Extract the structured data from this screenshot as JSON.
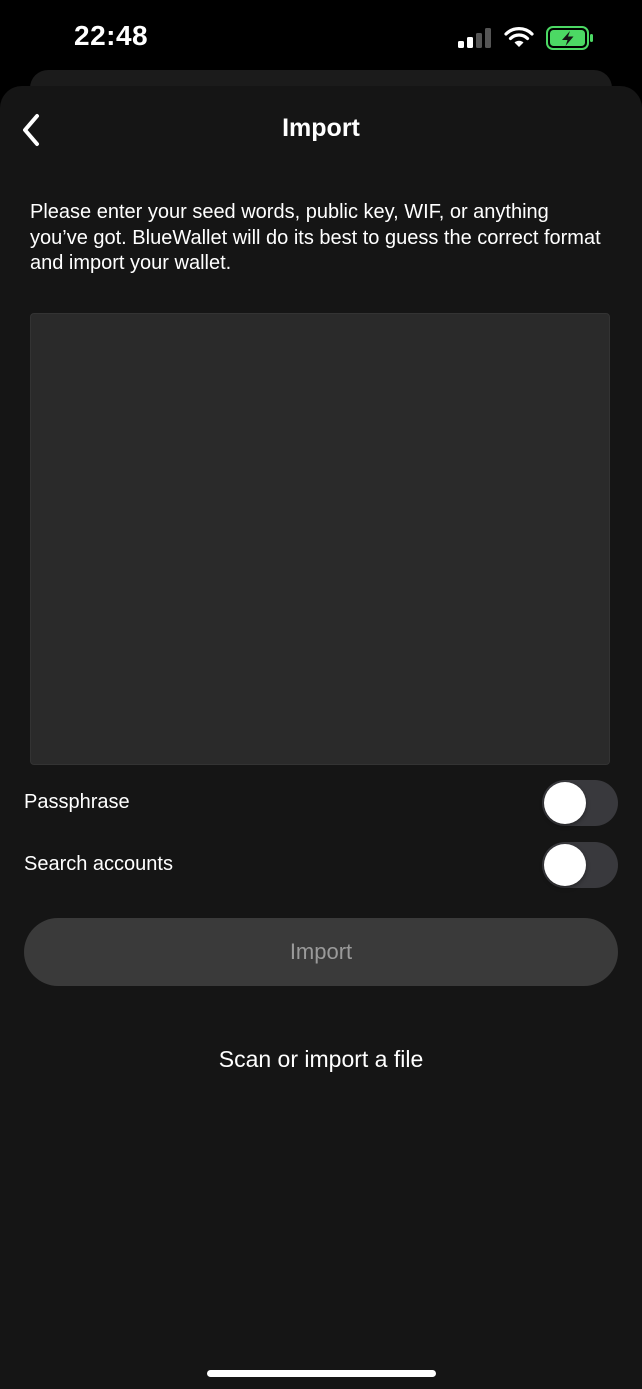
{
  "status_bar": {
    "time": "22:48",
    "icons": [
      "signal-icon",
      "wifi-icon",
      "battery-charging-icon"
    ],
    "battery_color": "#4cd964"
  },
  "header": {
    "back_icon": "chevron-left-icon",
    "title": "Import"
  },
  "form": {
    "instructions": "Please enter your seed words, public key, WIF, or anything you’ve got. BlueWallet will do its best to guess the correct format and import your wallet.",
    "seed_input_value": "",
    "toggles": [
      {
        "label": "Passphrase",
        "on": false
      },
      {
        "label": "Search accounts",
        "on": false
      }
    ],
    "import_button_label": "Import",
    "scan_link_label": "Scan or import a file"
  },
  "colors": {
    "background": "#151515",
    "input_background": "#2a2a2a",
    "button_background": "#3a3a3a",
    "button_text_disabled": "#9a9a9a"
  }
}
